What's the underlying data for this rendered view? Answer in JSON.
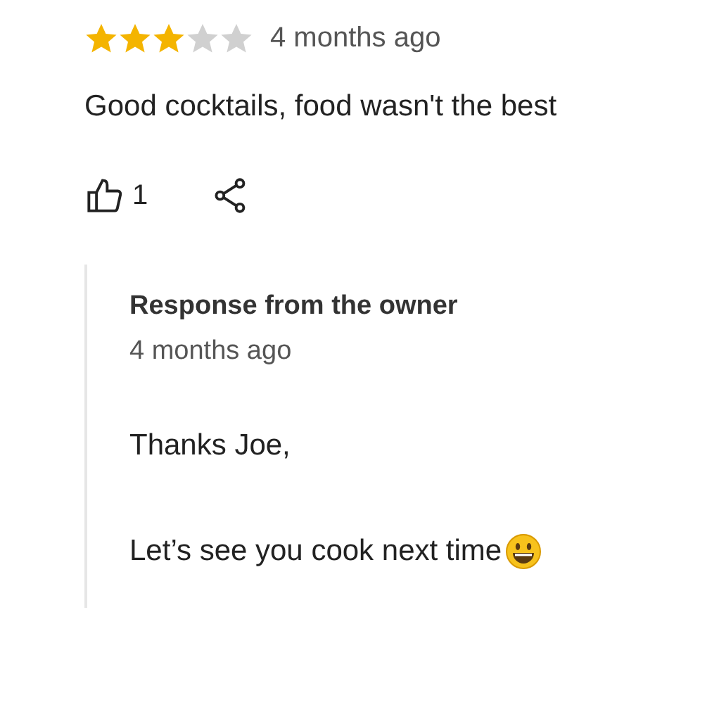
{
  "review": {
    "stars": 3,
    "time": "4 months ago",
    "text": "Good cocktails, food wasn't the best",
    "likes": "1"
  },
  "response": {
    "title": "Response from the owner",
    "time": "4 months ago",
    "paragraphs": [
      "Thanks Joe,",
      "Let’s see you cook next time"
    ]
  }
}
